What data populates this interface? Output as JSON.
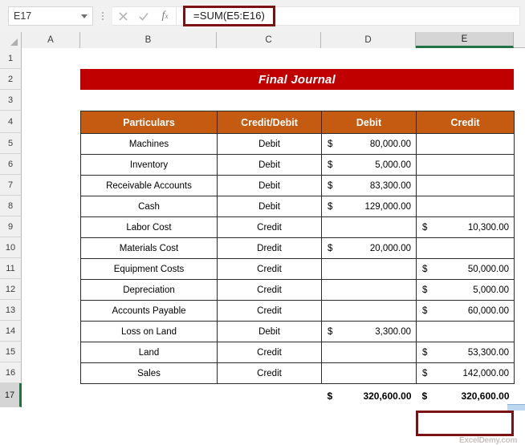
{
  "formula_bar": {
    "name_box_value": "E17",
    "cancel_icon": "close-icon",
    "confirm_icon": "check-icon",
    "fx_label": "fx",
    "formula_value": "=SUM(E5:E16)",
    "highlight_color": "#7b1113"
  },
  "grid": {
    "column_headers": [
      "A",
      "B",
      "C",
      "D",
      "E"
    ],
    "selected_column": "E",
    "row_headers": [
      "1",
      "2",
      "3",
      "4",
      "5",
      "6",
      "7",
      "8",
      "9",
      "10",
      "11",
      "12",
      "13",
      "14",
      "15",
      "16",
      "17"
    ],
    "selected_row": "17",
    "selection_accent": "#217346"
  },
  "sheet": {
    "title": "Final Journal",
    "title_bg": "#c00000",
    "header_bg": "#c55a11",
    "columns": [
      "Particulars",
      "Credit/Debit",
      "Debit",
      "Credit"
    ],
    "rows": [
      {
        "particulars": "Machines",
        "type": "Debit",
        "debit_cur": "$",
        "debit": "80,000.00",
        "credit_cur": "",
        "credit": ""
      },
      {
        "particulars": "Inventory",
        "type": "Debit",
        "debit_cur": "$",
        "debit": "5,000.00",
        "credit_cur": "",
        "credit": ""
      },
      {
        "particulars": "Receivable Accounts",
        "type": "Debit",
        "debit_cur": "$",
        "debit": "83,300.00",
        "credit_cur": "",
        "credit": ""
      },
      {
        "particulars": "Cash",
        "type": "Debit",
        "debit_cur": "$",
        "debit": "129,000.00",
        "credit_cur": "",
        "credit": ""
      },
      {
        "particulars": "Labor Cost",
        "type": "Credit",
        "debit_cur": "",
        "debit": "",
        "credit_cur": "$",
        "credit": "10,300.00"
      },
      {
        "particulars": "Materials Cost",
        "type": "Dredit",
        "debit_cur": "$",
        "debit": "20,000.00",
        "credit_cur": "",
        "credit": ""
      },
      {
        "particulars": "Equipment Costs",
        "type": "Credit",
        "debit_cur": "",
        "debit": "",
        "credit_cur": "$",
        "credit": "50,000.00"
      },
      {
        "particulars": "Depreciation",
        "type": "Credit",
        "debit_cur": "",
        "debit": "",
        "credit_cur": "$",
        "credit": "5,000.00"
      },
      {
        "particulars": "Accounts Payable",
        "type": "Credit",
        "debit_cur": "",
        "debit": "",
        "credit_cur": "$",
        "credit": "60,000.00"
      },
      {
        "particulars": "Loss on Land",
        "type": "Debit",
        "debit_cur": "$",
        "debit": "3,300.00",
        "credit_cur": "",
        "credit": ""
      },
      {
        "particulars": "Land",
        "type": "Credit",
        "debit_cur": "",
        "debit": "",
        "credit_cur": "$",
        "credit": "53,300.00"
      },
      {
        "particulars": "Sales",
        "type": "Credit",
        "debit_cur": "",
        "debit": "",
        "credit_cur": "$",
        "credit": "142,000.00"
      }
    ],
    "totals": {
      "particulars": "",
      "type": "",
      "debit_cur": "$",
      "debit": "320,600.00",
      "credit_cur": "$",
      "credit": "320,600.00"
    }
  },
  "watermark": {
    "text": "ExcelDemy.com"
  }
}
